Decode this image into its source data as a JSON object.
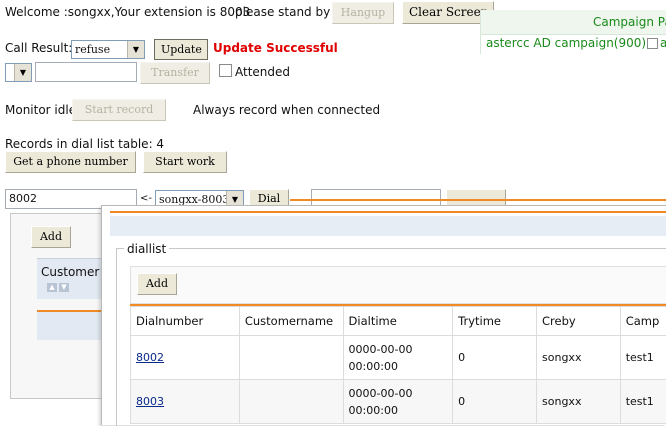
{
  "header": {
    "welcome": "Welcome :songxx,Your extension is 8003",
    "stand_by": "please stand by",
    "hangup": "Hangup",
    "clear_screen": "Clear Screen"
  },
  "campaign_panel": {
    "title": "Campaign Pa",
    "item": "astercc AD campaign(900)",
    "item_suffix": "a"
  },
  "call_result": {
    "label": "Call Result:",
    "value": "refuse",
    "update": "Update",
    "status": "Update Successful"
  },
  "transfer": {
    "select_value": "",
    "input_value": "",
    "transfer_button": "Transfer",
    "attended_label": "Attended"
  },
  "monitor": {
    "status": "Monitor idle",
    "start_record": "Start record",
    "note": "Always record when connected"
  },
  "records": {
    "label": "Records in dial list table: 4",
    "get_phone": "Get a phone number",
    "start_work": "Start work"
  },
  "dial": {
    "number_value": "8002",
    "arrow": "<-",
    "extension": "songxx-8003",
    "dial_button": "Dial"
  },
  "bg_panel": {
    "add": "Add",
    "column": "Customer N"
  },
  "dialog": {
    "legend": "diallist",
    "add": "Add",
    "columns": [
      "Dialnumber",
      "Customername",
      "Dialtime",
      "Trytime",
      "Creby",
      "Camp"
    ],
    "rows": [
      {
        "dialnumber": "8002",
        "customername": "",
        "dialtime_date": "0000-00-00",
        "dialtime_time": "00:00:00",
        "trytime": "0",
        "creby": "songxx",
        "campaign": "test1"
      },
      {
        "dialnumber": "8003",
        "customername": "",
        "dialtime_date": "0000-00-00",
        "dialtime_time": "00:00:00",
        "trytime": "0",
        "creby": "songxx",
        "campaign": "test1"
      }
    ]
  },
  "colors": {
    "accent": "#f08a24",
    "success_red": "#e00000",
    "campaign_green": "#1a8a1a"
  }
}
